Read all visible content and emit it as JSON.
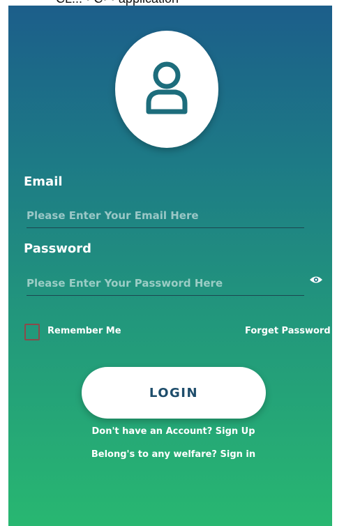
{
  "header": {
    "title_fragment": "CL... • C• • application"
  },
  "avatar": {
    "icon": "user-icon",
    "icon_color": "#1d6d7c"
  },
  "form": {
    "email_label": "Email",
    "email_placeholder": "Please Enter Your Email Here",
    "email_value": "",
    "password_label": "Password",
    "password_placeholder": "Please Enter Your Password Here",
    "password_value": "",
    "password_toggle_icon": "eye-icon",
    "remember_me_label": "Remember Me",
    "remember_me_checked": false,
    "forgot_password_label": "Forget Password ?",
    "login_label": "LOGIN"
  },
  "links": {
    "signup": "Don't have an Account? Sign Up",
    "welfare_signin": "Belong's to any welfare? Sign in"
  },
  "colors": {
    "gradient_top": "#1c5e8a",
    "gradient_bottom": "#28b771",
    "button_text": "#1e4d6b",
    "input_underline": "#1b4650"
  }
}
